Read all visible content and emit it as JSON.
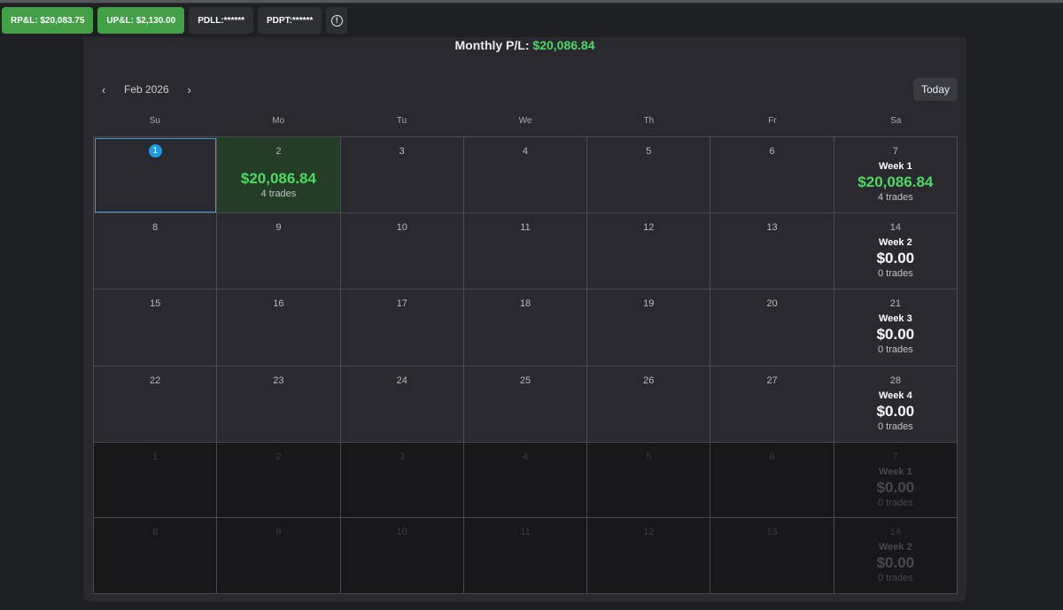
{
  "pills": {
    "rpl": "RP&L: $20,083.75",
    "upl": "UP&L: $2,130.00",
    "pdll": "PDLL:******",
    "pdpt": "PDPT:******",
    "info_icon": "!"
  },
  "header": {
    "monthly_label": "Monthly P/L:",
    "monthly_value": "$20,086.84"
  },
  "nav": {
    "prev": "‹",
    "month": "Feb 2026",
    "next": "›",
    "today": "Today"
  },
  "weekdays": [
    "Su",
    "Mo",
    "Tu",
    "We",
    "Th",
    "Fr",
    "Sa"
  ],
  "colors": {
    "profit": "#4cd964",
    "selected": "#1e9be0",
    "pill_green": "#43a047"
  },
  "weeks": [
    {
      "days": [
        {
          "num": "1",
          "state": "selected"
        },
        {
          "num": "2",
          "state": "profit",
          "pl": "$20,086.84",
          "trades": "4 trades"
        },
        {
          "num": "3"
        },
        {
          "num": "4"
        },
        {
          "num": "5"
        },
        {
          "num": "6"
        }
      ],
      "summary": {
        "num": "7",
        "label": "Week 1",
        "pl": "$20,086.84",
        "trades": "4 trades",
        "positive": true
      }
    },
    {
      "days": [
        {
          "num": "8"
        },
        {
          "num": "9"
        },
        {
          "num": "10"
        },
        {
          "num": "11"
        },
        {
          "num": "12"
        },
        {
          "num": "13"
        }
      ],
      "summary": {
        "num": "14",
        "label": "Week 2",
        "pl": "$0.00",
        "trades": "0 trades"
      }
    },
    {
      "days": [
        {
          "num": "15"
        },
        {
          "num": "16"
        },
        {
          "num": "17"
        },
        {
          "num": "18"
        },
        {
          "num": "19"
        },
        {
          "num": "20"
        }
      ],
      "summary": {
        "num": "21",
        "label": "Week 3",
        "pl": "$0.00",
        "trades": "0 trades"
      }
    },
    {
      "days": [
        {
          "num": "22"
        },
        {
          "num": "23"
        },
        {
          "num": "24"
        },
        {
          "num": "25"
        },
        {
          "num": "26"
        },
        {
          "num": "27"
        }
      ],
      "summary": {
        "num": "28",
        "label": "Week 4",
        "pl": "$0.00",
        "trades": "0 trades"
      }
    },
    {
      "past": true,
      "days": [
        {
          "num": "1"
        },
        {
          "num": "2"
        },
        {
          "num": "3"
        },
        {
          "num": "4"
        },
        {
          "num": "5"
        },
        {
          "num": "6"
        }
      ],
      "summary": {
        "num": "7",
        "label": "Week 1",
        "pl": "$0.00",
        "trades": "0 trades"
      }
    },
    {
      "past": true,
      "days": [
        {
          "num": "8"
        },
        {
          "num": "9"
        },
        {
          "num": "10"
        },
        {
          "num": "11"
        },
        {
          "num": "12"
        },
        {
          "num": "13"
        }
      ],
      "summary": {
        "num": "14",
        "label": "Week 2",
        "pl": "$0.00",
        "trades": "0 trades"
      }
    }
  ]
}
